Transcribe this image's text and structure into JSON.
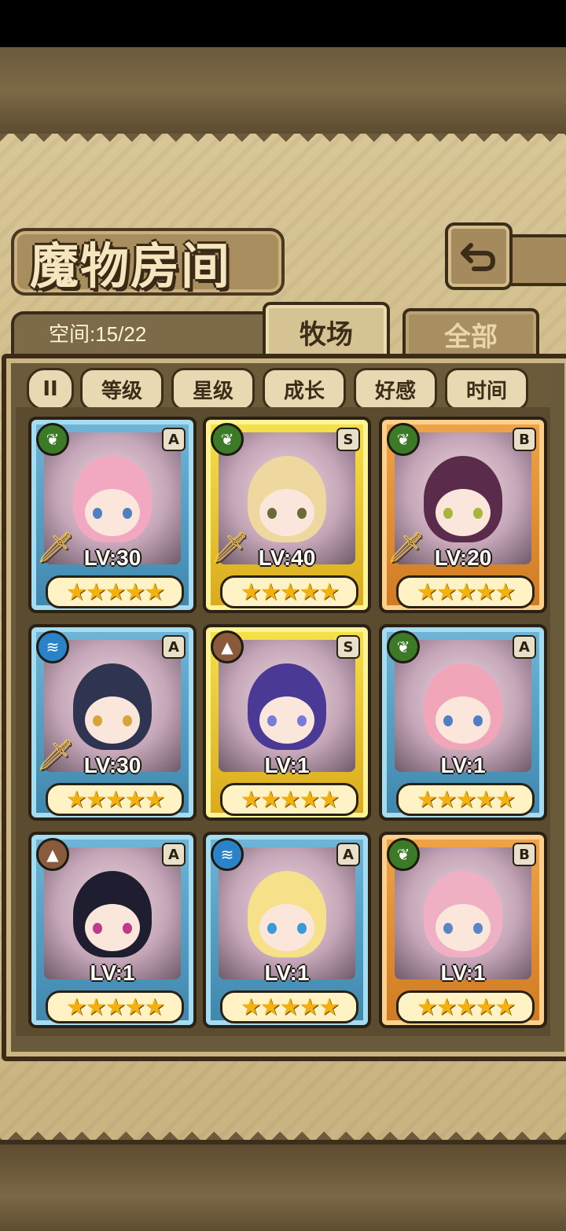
{
  "title": "魔物房间",
  "space_label": "空间:15/22",
  "tabs": [
    {
      "label": "牧场",
      "active": true
    },
    {
      "label": "全部",
      "active": false
    }
  ],
  "sort_icon": "II",
  "filters": [
    "等级",
    "星级",
    "成长",
    "好感",
    "时间"
  ],
  "cards": [
    {
      "element": "leaf",
      "rank": "A",
      "level": "LV:30",
      "stars": "★★★★★",
      "frame": "blue",
      "weapon": true,
      "hair": "#f2a8c0",
      "eye": "#4f7fc2"
    },
    {
      "element": "leaf",
      "rank": "S",
      "level": "LV:40",
      "stars": "★★★★★",
      "frame": "gold",
      "weapon": true,
      "hair": "#efd7a0",
      "eye": "#6a6a3a"
    },
    {
      "element": "leaf",
      "rank": "B",
      "level": "LV:20",
      "stars": "★★★★★",
      "frame": "orange",
      "weapon": true,
      "hair": "#5a2b4a",
      "eye": "#a6b63a"
    },
    {
      "element": "water",
      "rank": "A",
      "level": "LV:30",
      "stars": "★★★★★",
      "frame": "blue",
      "weapon": true,
      "hair": "#2f3450",
      "eye": "#d6a53a"
    },
    {
      "element": "earth",
      "rank": "S",
      "level": "LV:1",
      "stars": "★★★★★",
      "frame": "gold",
      "weapon": false,
      "hair": "#4a3a96",
      "eye": "#7a7ad8"
    },
    {
      "element": "leaf",
      "rank": "A",
      "level": "LV:1",
      "stars": "★★★★★",
      "frame": "blue",
      "weapon": false,
      "hair": "#f0a6b8",
      "eye": "#4f7fc2"
    },
    {
      "element": "earth",
      "rank": "A",
      "level": "LV:1",
      "stars": "★★★★★",
      "frame": "blue",
      "weapon": false,
      "hair": "#1f1e30",
      "eye": "#c03a8a"
    },
    {
      "element": "water",
      "rank": "A",
      "level": "LV:1",
      "stars": "★★★★★",
      "frame": "blue",
      "weapon": false,
      "hair": "#f6e08a",
      "eye": "#3a9ad8"
    },
    {
      "element": "leaf",
      "rank": "B",
      "level": "LV:1",
      "stars": "★★★★★",
      "frame": "orange",
      "weapon": false,
      "hair": "#f0b0c4",
      "eye": "#5a86c8"
    }
  ],
  "icons": {
    "back": "return-arrow-icon",
    "leaf": "leaf-element-icon",
    "water": "water-element-icon",
    "earth": "earth-element-icon",
    "weapon": "sword-icon"
  }
}
